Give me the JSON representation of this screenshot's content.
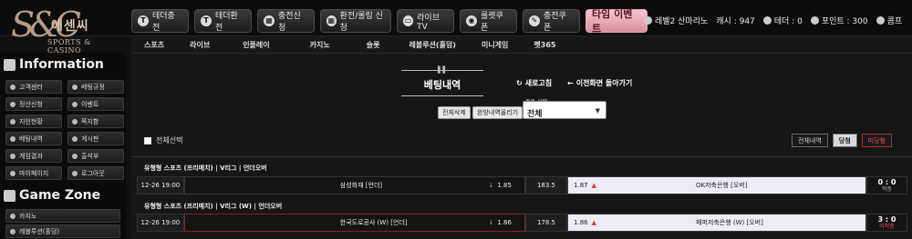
{
  "brand": {
    "monogram": "S&C",
    "name_ko": "에센씨",
    "name_en": "SPORTS & CASINO"
  },
  "topnav": [
    {
      "label": "테더충전",
      "icon": "tether-icon"
    },
    {
      "label": "테더환전",
      "icon": "tether-icon"
    },
    {
      "label": "충전신청",
      "icon": "building-icon"
    },
    {
      "label": "환전/롤링 신청",
      "icon": "building-icon"
    },
    {
      "label": "라이브TV",
      "icon": "tv-icon"
    },
    {
      "label": "룰렛쿠폰",
      "icon": "roulette-icon"
    },
    {
      "label": "충전쿠폰",
      "icon": "ticket-icon"
    },
    {
      "label": "타임 이벤트",
      "icon": ""
    }
  ],
  "user": {
    "level": "레벨2 산마리노",
    "cash": "캐시 : 947",
    "tether": "테더 : 0",
    "point": "포인트 : 300",
    "comp": "콤프"
  },
  "subnav": [
    "스포츠",
    "라이브",
    "인플레이",
    "카지노",
    "슬롯",
    "레볼루션(홀덤)",
    "미니게임",
    "펫365"
  ],
  "sidebar": {
    "info_title": "Information",
    "info_items": [
      "고객센터",
      "베팅규정",
      "정산신청",
      "이벤트",
      "지인현황",
      "쪽지함",
      "베팅내역",
      "게시판",
      "게임결과",
      "출석부",
      "마이페이지",
      "로그아웃"
    ],
    "game_title": "Game Zone",
    "game_items": [
      "카지노",
      "레볼루션(홀덤)"
    ]
  },
  "main": {
    "title": "베팅내역",
    "refresh": "새로고침",
    "back": "이전화면 돌아가기",
    "delete_all": "전체삭제",
    "delete_done": "완방내역올리기",
    "select_label": "종목 선택",
    "select_value": "전체",
    "select_all": "전체선택",
    "filters": [
      "전체내역",
      "당첨",
      "미당첨"
    ]
  },
  "bets": [
    {
      "header": "유형형 스포츠 (프리매치) | V리그 | 언더오버",
      "time": "12-26 19:00",
      "home": "삼성화재 [언더]",
      "home_odds": "1.85",
      "mid": "183.5",
      "away_odds": "1.87",
      "away": "OK저축은행 [오버]",
      "score": "0 : 0",
      "status": "적중"
    },
    {
      "header": "유형형 스포츠 (프리매치) | V리그 (W) | 언더오버",
      "time": "12-26 19:00",
      "home": "한국도로공사 (W) [언더]",
      "home_odds": "1.86",
      "mid": "178.5",
      "away_odds": "1.86",
      "away": "페퍼저축은행 (W) [오버]",
      "score": "3 : 0",
      "status": "미적중"
    }
  ]
}
